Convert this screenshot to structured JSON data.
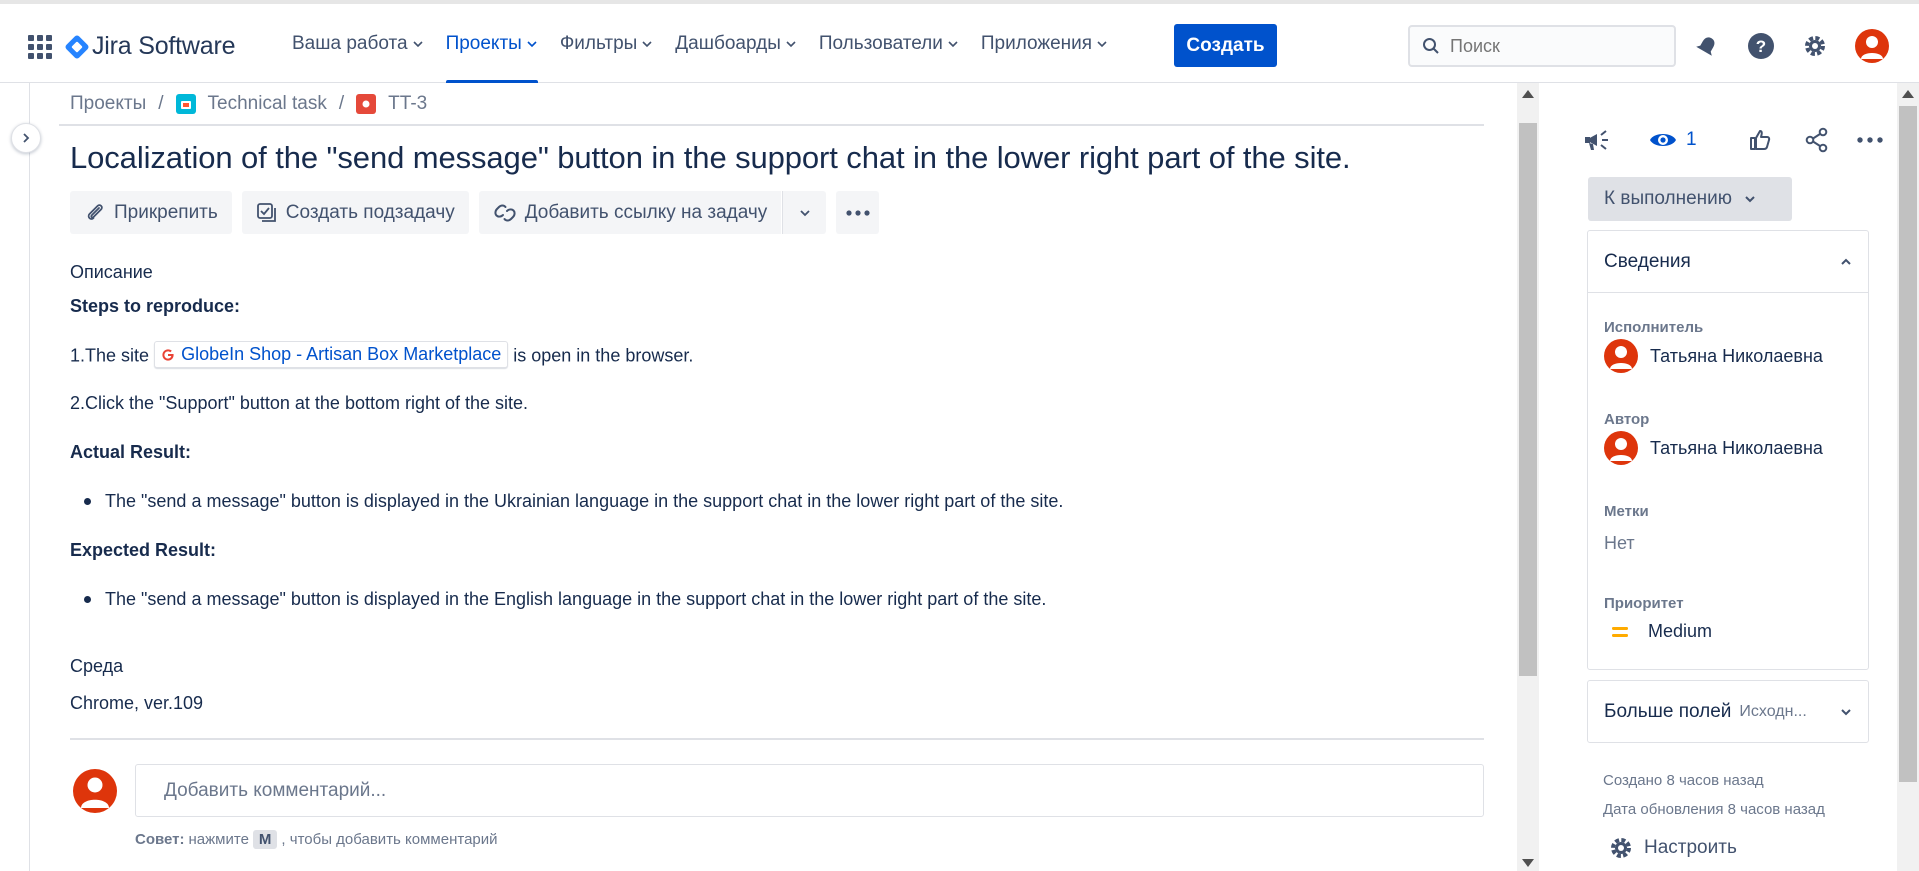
{
  "app": {
    "name": "Jira Software"
  },
  "nav": {
    "items": [
      {
        "label": "Ваша работа",
        "active": false
      },
      {
        "label": "Проекты",
        "active": true
      },
      {
        "label": "Фильтры",
        "active": false
      },
      {
        "label": "Дашбоарды",
        "active": false
      },
      {
        "label": "Пользователи",
        "active": false
      },
      {
        "label": "Приложения",
        "active": false
      }
    ],
    "create_label": "Создать",
    "search_placeholder": "Поиск"
  },
  "breadcrumb": {
    "root": "Проекты",
    "project": "Technical task",
    "issue": "TT-3"
  },
  "issue": {
    "title": "Localization of the \"send message\" button in the support chat in the lower right part of the site.",
    "toolbar": {
      "attach": "Прикрепить",
      "subtask": "Создать подзадачу",
      "link": "Добавить ссылку на задачу"
    },
    "description_label": "Описание",
    "steps_heading": "Steps to reproduce:",
    "step1_prefix": "1.The site",
    "step1_link": "GlobeIn Shop - Artisan Box Marketplace",
    "step1_suffix": "is open in the browser.",
    "step2": "2.Click the \"Support\" button at the bottom right of the site.",
    "actual_heading": "Actual Result:",
    "actual_item": "The \"send a message\" button is displayed in the Ukrainian language in the support chat in the lower right part of the site.",
    "expected_heading": "Expected Result:",
    "expected_item": "The \"send a message\" button is displayed in the English language in the support chat in the lower right part of the site.",
    "environment_label": "Среда",
    "environment_value": "Chrome, ver.109"
  },
  "comment": {
    "placeholder": "Добавить комментарий...",
    "tip_bold": "Совет:",
    "tip_pre": "нажмите",
    "tip_key": "M",
    "tip_post": ", чтобы добавить комментарий"
  },
  "sidebar": {
    "watch_count": "1",
    "status": "К выполнению",
    "details_title": "Сведения",
    "assignee_label": "Исполнитель",
    "assignee": "Татьяна Николаевна",
    "reporter_label": "Автор",
    "reporter": "Татьяна Николаевна",
    "labels_label": "Метки",
    "labels_value": "Нет",
    "priority_label": "Приоритет",
    "priority_value": "Medium",
    "more_fields": "Больше полей",
    "more_fields_hint": "Исходн...",
    "created": "Создано 8 часов назад",
    "updated": "Дата обновления 8 часов назад",
    "configure": "Настроить"
  },
  "colors": {
    "accent": "#0052cc",
    "avatar": "#de350b",
    "priority": "#ffab00"
  }
}
